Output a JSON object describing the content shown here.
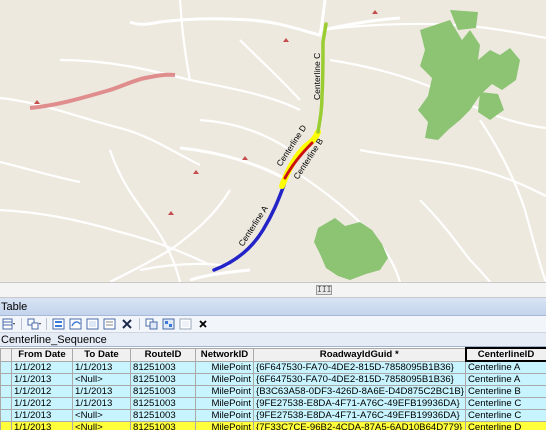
{
  "map": {
    "route_labels": {
      "a": "Centerline A",
      "b": "Centerline B",
      "c": "Centerline C",
      "d": "Centerline D"
    },
    "colors": {
      "background": "#ede9df",
      "road": "#ffffff",
      "major_road": "#e08d8d",
      "forest": "#8cc474",
      "centerline_a": "#2323c8",
      "centerline_b": "#cc1111",
      "centerline_c": "#9acd32",
      "centerline_d": "#ffff00"
    }
  },
  "scroll": {
    "grip_label": "III"
  },
  "table_window": {
    "title": "Table"
  },
  "table_tab": {
    "label": "Centerline_Sequence"
  },
  "toolbar": {
    "buttons": [
      "table-options-icon",
      "related-tables-icon",
      "select-by-attributes-icon",
      "switch-selection-icon",
      "clear-selection-icon",
      "zoom-to-selected-icon",
      "delete-selected-icon",
      "copy-icon",
      "select-all-icon",
      "export-icon",
      "close-icon"
    ]
  },
  "grid": {
    "columns": [
      "From Date",
      "To Date",
      "RouteID",
      "NetworkID",
      "RoadwayIdGuid *",
      "CenterlineID"
    ],
    "rows": [
      {
        "from": "1/1/2012",
        "to": "1/1/2013",
        "route": "81251003",
        "network": "MilePoint",
        "guid": "{6F647530-FA70-4DE2-815D-7858095B1B36}",
        "centerline": "Centerline A"
      },
      {
        "from": "1/1/2013",
        "to": "<Null>",
        "route": "81251003",
        "network": "MilePoint",
        "guid": "{6F647530-FA70-4DE2-815D-7858095B1B36}",
        "centerline": "Centerline A"
      },
      {
        "from": "1/1/2012",
        "to": "1/1/2013",
        "route": "81251003",
        "network": "MilePoint",
        "guid": "{B3C63A58-0DF3-426D-8A6E-D4D875C2BC1B}",
        "centerline": "Centerline B"
      },
      {
        "from": "1/1/2012",
        "to": "1/1/2013",
        "route": "81251003",
        "network": "MilePoint",
        "guid": "{9FE27538-E8DA-4F71-A76C-49EFB19936DA}",
        "centerline": "Centerline C"
      },
      {
        "from": "1/1/2013",
        "to": "<Null>",
        "route": "81251003",
        "network": "MilePoint",
        "guid": "{9FE27538-E8DA-4F71-A76C-49EFB19936DA}",
        "centerline": "Centerline C"
      },
      {
        "from": "1/1/2013",
        "to": "<Null>",
        "route": "81251003",
        "network": "MilePoint",
        "guid": "{7F33C7CE-96B2-4CDA-87A5-6AD10B64D779}",
        "centerline": "Centerline D"
      }
    ]
  }
}
